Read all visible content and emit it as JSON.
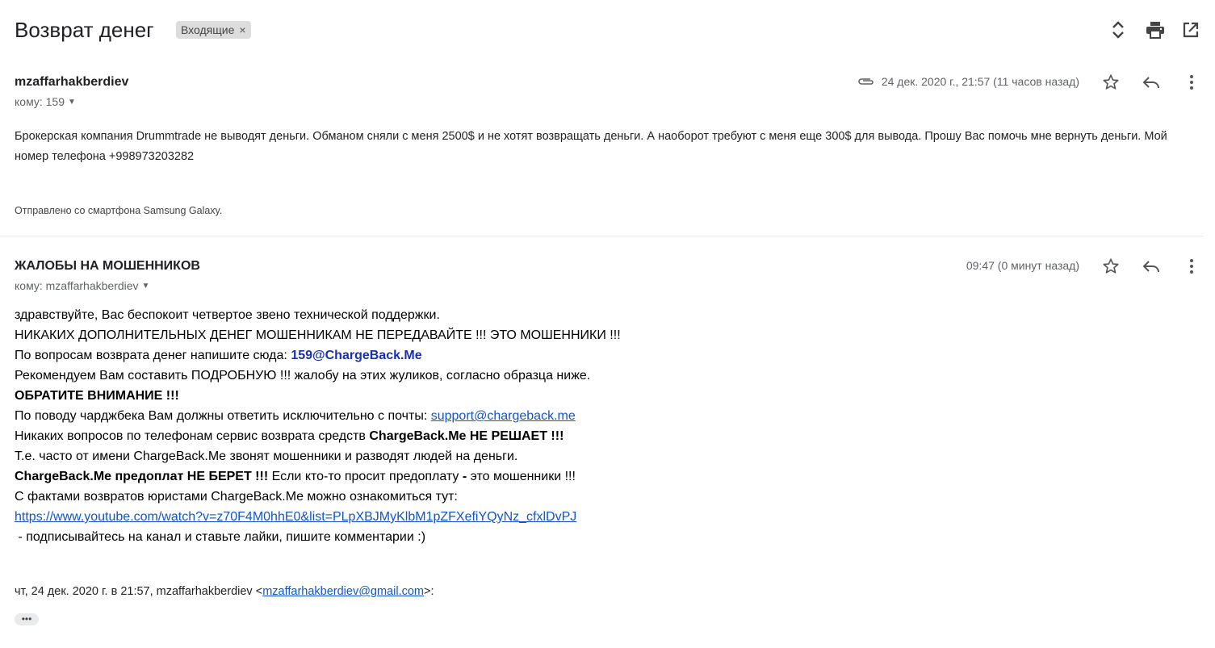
{
  "header": {
    "subject": "Возврат денег",
    "label": "Входящие",
    "label_remove": "×"
  },
  "messages": [
    {
      "sender": "mzaffarhakberdiev",
      "to": "кому: 159",
      "has_attachment": true,
      "date": "24 дек. 2020 г., 21:57 (11 часов назад)",
      "body": "Брокерская компания Drummtrade не выводят деньги. Обманом сняли с меня 2500$ и не хотят возвращать деньги. А наоборот требуют с меня еще 300$ для вывода. Прошу Вас помочь мне вернуть деньги. Мой номер телефона +998973203282",
      "signature": "Отправлено со смартфона Samsung Galaxy."
    },
    {
      "sender": "ЖАЛОБЫ НА МОШЕННИКОВ",
      "to": "кому: mzaffarhakberdiev",
      "date": "09:47 (0 минут назад)",
      "lines": {
        "l1": "здравствуйте, Вас беспокоит четвертое звено технической поддержки.",
        "l2": "НИКАКИХ ДОПОЛНИТЕЛЬНЫХ ДЕНЕГ МОШЕННИКАМ НЕ ПЕРЕДАВАЙТЕ !!! ЭТО МОШЕННИКИ !!!",
        "l3_text": "По вопросам возврата денег напишите сюда: ",
        "l3_email": "159@ChargeBack.Me",
        "l4": "Рекомендуем Вам составить ПОДРОБНУЮ !!! жалобу на этих жуликов, согласно образца ниже.",
        "l5": "ОБРАТИТЕ ВНИМАНИЕ !!!",
        "l6_text": "По поводу чарджбека Вам должны ответить исключительно с почты: ",
        "l6_email": "support@chargeback.me",
        "l7_text": "Никаких вопросов по телефонам сервис возврата средств ",
        "l7_bold": "ChargeBack.Me НЕ РЕШАЕТ !!!",
        "l8": "Т.е. часто от имени ChargeBack.Me звонят мошенники и разводят людей на деньги.",
        "l9_bold": "ChargeBack.Me предоплат НЕ БЕРЕТ !!!",
        "l9_text1": " Если кто-то просит предоплату ",
        "l9_dash": "-",
        "l9_text2": " это мошенники !!!",
        "l10": "С фактами возвратов юристами ChargeBack.Me можно ознакомиться тут:",
        "l11_link": "https://www.youtube.com/watch?v=z70F4M0hhE0&list=PLpXBJMyKlbM1pZFXefiYQyNz_cfxlDvPJ",
        "l12": " - подписывайтесь на канал и ставьте лайки, пишите комментарии :)"
      },
      "quote_prefix": "чт, 24 дек. 2020 г. в 21:57, mzaffarhakberdiev <",
      "quote_email": "mzaffarhakberdiev@gmail.com",
      "quote_suffix": ">:",
      "show_trimmed": "•••"
    }
  ],
  "icons": {
    "expand": "expand-collapse-icon",
    "print": "print-icon",
    "popout": "open-in-new-window-icon",
    "attachment": "paperclip-icon",
    "star": "star-icon",
    "reply": "reply-icon",
    "more": "more-vertical-icon"
  },
  "colors": {
    "link": "#1155cc",
    "email_highlight": "#1a2fb0",
    "chip_bg": "#dddddd",
    "icon": "#444444"
  }
}
